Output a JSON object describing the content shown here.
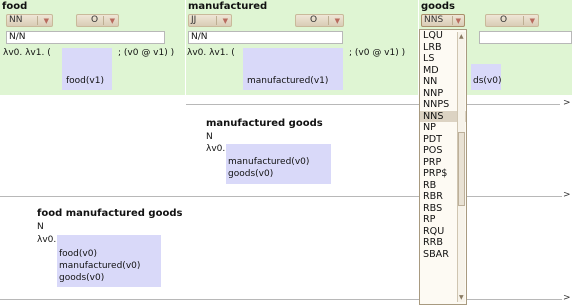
{
  "columns": [
    {
      "word": "food",
      "tag": "NN",
      "category": "O",
      "syntax": "N/N",
      "lambda": "λv0. λv1. (",
      "pred": "food(v1)",
      "suffix": "; (v0 @ v1) )"
    },
    {
      "word": "manufactured",
      "tag": "JJ",
      "category": "O",
      "syntax": "N/N",
      "lambda": "λv0. λv1. (",
      "pred": "manufactured(v1)",
      "suffix": "; (v0 @ v1) )"
    },
    {
      "word": "goods",
      "tag": "NNS",
      "category": "O",
      "pred_partial": "ds(v0)"
    }
  ],
  "results": [
    {
      "title": "manufactured goods",
      "cat": "N",
      "lambda": "λv0.",
      "preds": [
        "manufactured(v0)",
        "goods(v0)"
      ]
    },
    {
      "title": "food manufactured goods",
      "cat": "N",
      "lambda": "λv0.",
      "preds": [
        "food(v0)",
        "manufactured(v0)",
        "goods(v0)"
      ]
    }
  ],
  "chevron": ">",
  "dropdown": {
    "selected": "NNS",
    "options": [
      "LQU",
      "LRB",
      "LS",
      "MD",
      "NN",
      "NNP",
      "NNPS",
      "NNS",
      "NP",
      "PDT",
      "POS",
      "PRP",
      "PRP$",
      "RB",
      "RBR",
      "RBS",
      "RP",
      "RQU",
      "RRB",
      "SBAR"
    ]
  },
  "icons": {
    "select_arrow": "▼",
    "scroll_up": "▲",
    "scroll_down": "▼"
  }
}
